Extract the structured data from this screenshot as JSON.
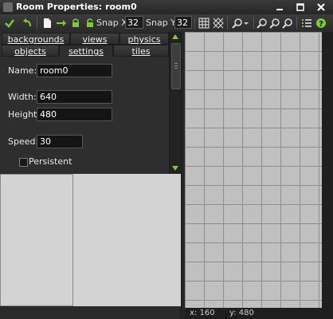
{
  "window": {
    "title": "Room Properties: room0",
    "controls": [
      "minimize-icon",
      "maximize-icon",
      "close-icon"
    ]
  },
  "toolbar": {
    "snap_x_label": "Snap X",
    "snap_x_value": "32",
    "snap_y_label": "Snap Y",
    "snap_y_value": "32",
    "icons": [
      "confirm-icon",
      "undo-icon",
      "new-icon",
      "shift-icon",
      "lock-icon",
      "unlock-icon",
      "grid-icon",
      "isometric-icon",
      "zoom-icon",
      "zoom-in-icon",
      "zoom-out-icon",
      "zoom-reset-icon",
      "list-icon",
      "help-icon"
    ]
  },
  "tabs": {
    "row1": [
      "backgrounds",
      "views",
      "physics"
    ],
    "row2": [
      "objects",
      "settings",
      "tiles"
    ],
    "active": "settings"
  },
  "settings": {
    "name_label": "Name:",
    "name_value": "room0",
    "width_label": "Width:",
    "width_value": "640",
    "height_label": "Height:",
    "height_value": "480",
    "speed_label": "Speed:",
    "speed_value": "30",
    "persistent_label": "Persistent",
    "persistent_checked": false
  },
  "status": {
    "x": "x: 160",
    "y": "y: 480"
  },
  "colors": {
    "accent": "#7ec83a",
    "panel": "#2e2e2e",
    "grid_fill": "#c0c0c0",
    "grid_line": "#8f8f8f"
  }
}
